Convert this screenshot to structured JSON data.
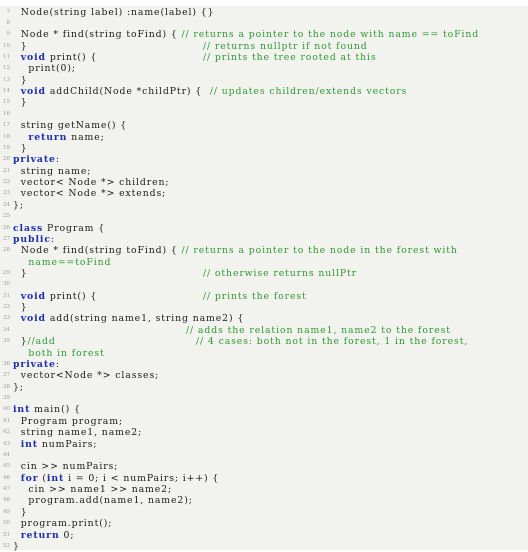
{
  "colors": {
    "keyword": "#1c2fb0",
    "comment": "#2e9a2e",
    "text": "#1a1a1a",
    "background": "#f2f2ef",
    "line_number": "#9a9a9a"
  },
  "lines": [
    {
      "n": "7",
      "segs": [
        {
          "t": "  Node(string label) :name(label) {}",
          "c": ""
        }
      ]
    },
    {
      "n": "8",
      "segs": []
    },
    {
      "n": "9",
      "segs": [
        {
          "t": "  Node * find(string toFind) { ",
          "c": ""
        },
        {
          "t": "// returns a pointer to the node with name == toFind",
          "c": "cm"
        }
      ]
    },
    {
      "n": "10",
      "segs": [
        {
          "t": "  }",
          "c": ""
        }
      ],
      "comment": "// returns nullptr if not found"
    },
    {
      "n": "11",
      "segs": [
        {
          "t": "  ",
          "c": ""
        },
        {
          "t": "void",
          "c": "kw"
        },
        {
          "t": " print() {",
          "c": ""
        }
      ],
      "comment": "// prints the tree rooted at this"
    },
    {
      "n": "12",
      "segs": [
        {
          "t": "    print(0);",
          "c": ""
        }
      ]
    },
    {
      "n": "13",
      "segs": [
        {
          "t": "  }",
          "c": ""
        }
      ]
    },
    {
      "n": "14",
      "segs": [
        {
          "t": "  ",
          "c": ""
        },
        {
          "t": "void",
          "c": "kw"
        },
        {
          "t": " addChild(Node *childPtr) {  ",
          "c": ""
        },
        {
          "t": "// updates children/extends vectors",
          "c": "cm"
        }
      ]
    },
    {
      "n": "15",
      "segs": [
        {
          "t": "  }",
          "c": ""
        }
      ]
    },
    {
      "n": "16",
      "segs": []
    },
    {
      "n": "17",
      "segs": [
        {
          "t": "  string getName() {",
          "c": ""
        }
      ]
    },
    {
      "n": "18",
      "segs": [
        {
          "t": "    ",
          "c": ""
        },
        {
          "t": "return",
          "c": "kw"
        },
        {
          "t": " name;",
          "c": ""
        }
      ]
    },
    {
      "n": "19",
      "segs": [
        {
          "t": "  }",
          "c": ""
        }
      ]
    },
    {
      "n": "20",
      "segs": [
        {
          "t": "private",
          "c": "kw"
        },
        {
          "t": ":",
          "c": ""
        }
      ]
    },
    {
      "n": "21",
      "segs": [
        {
          "t": "  string name;",
          "c": ""
        }
      ]
    },
    {
      "n": "22",
      "segs": [
        {
          "t": "  vector< Node *> children;",
          "c": ""
        }
      ]
    },
    {
      "n": "23",
      "segs": [
        {
          "t": "  vector< Node *> extends;",
          "c": ""
        }
      ]
    },
    {
      "n": "24",
      "segs": [
        {
          "t": "};",
          "c": ""
        }
      ]
    },
    {
      "n": "25",
      "segs": []
    },
    {
      "n": "26",
      "segs": [
        {
          "t": "class",
          "c": "kw"
        },
        {
          "t": " Program {",
          "c": ""
        }
      ]
    },
    {
      "n": "27",
      "segs": [
        {
          "t": "public",
          "c": "kw"
        },
        {
          "t": ":",
          "c": ""
        }
      ]
    },
    {
      "n": "28",
      "segs": [
        {
          "t": "  Node * find(string toFind) { ",
          "c": ""
        },
        {
          "t": "// returns a pointer to the node in the forest with",
          "c": "cm"
        }
      ]
    },
    {
      "n": "",
      "segs": [
        {
          "t": "    name==toFind",
          "c": "cm"
        }
      ]
    },
    {
      "n": "29",
      "segs": [
        {
          "t": "  }",
          "c": ""
        }
      ],
      "comment": "// otherwise returns nullPtr"
    },
    {
      "n": "30",
      "segs": []
    },
    {
      "n": "31",
      "segs": [
        {
          "t": "  ",
          "c": ""
        },
        {
          "t": "void",
          "c": "kw"
        },
        {
          "t": " print() {",
          "c": ""
        }
      ],
      "comment": "// prints the forest"
    },
    {
      "n": "32",
      "segs": [
        {
          "t": "  }",
          "c": ""
        }
      ]
    },
    {
      "n": "33",
      "segs": [
        {
          "t": "  ",
          "c": ""
        },
        {
          "t": "void",
          "c": "kw"
        },
        {
          "t": " add(string name1, string name2) {",
          "c": ""
        }
      ]
    },
    {
      "n": "34",
      "segs": [],
      "comment2": "// adds the relation name1, name2 to the forest"
    },
    {
      "n": "35",
      "segs": [
        {
          "t": "  }",
          "c": ""
        },
        {
          "t": "//add",
          "c": "cm"
        }
      ],
      "comment3": "// 4 cases: both not in the forest, 1 in the forest,"
    },
    {
      "n": "",
      "segs": [
        {
          "t": "    both in forest",
          "c": "cm"
        }
      ]
    },
    {
      "n": "36",
      "segs": [
        {
          "t": "private",
          "c": "kw"
        },
        {
          "t": ":",
          "c": ""
        }
      ]
    },
    {
      "n": "37",
      "segs": [
        {
          "t": "  vector<Node *> classes;",
          "c": ""
        }
      ]
    },
    {
      "n": "38",
      "segs": [
        {
          "t": "};",
          "c": ""
        }
      ]
    },
    {
      "n": "39",
      "segs": []
    },
    {
      "n": "40",
      "segs": [
        {
          "t": "int",
          "c": "kw"
        },
        {
          "t": " main() {",
          "c": ""
        }
      ]
    },
    {
      "n": "41",
      "segs": [
        {
          "t": "  Program program;",
          "c": ""
        }
      ]
    },
    {
      "n": "42",
      "segs": [
        {
          "t": "  string name1, name2;",
          "c": ""
        }
      ]
    },
    {
      "n": "43",
      "segs": [
        {
          "t": "  ",
          "c": ""
        },
        {
          "t": "int",
          "c": "kw"
        },
        {
          "t": " numPairs;",
          "c": ""
        }
      ]
    },
    {
      "n": "44",
      "segs": []
    },
    {
      "n": "45",
      "segs": [
        {
          "t": "  cin >> numPairs;",
          "c": ""
        }
      ]
    },
    {
      "n": "46",
      "segs": [
        {
          "t": "  ",
          "c": ""
        },
        {
          "t": "for",
          "c": "kw"
        },
        {
          "t": " (",
          "c": ""
        },
        {
          "t": "int",
          "c": "kw"
        },
        {
          "t": " i = 0; i < numPairs; i++) {",
          "c": ""
        }
      ]
    },
    {
      "n": "47",
      "segs": [
        {
          "t": "    cin >> name1 >> name2;",
          "c": ""
        }
      ]
    },
    {
      "n": "48",
      "segs": [
        {
          "t": "    program.add(name1, name2);",
          "c": ""
        }
      ]
    },
    {
      "n": "49",
      "segs": [
        {
          "t": "  }",
          "c": ""
        }
      ]
    },
    {
      "n": "50",
      "segs": [
        {
          "t": "  program.print();",
          "c": ""
        }
      ]
    },
    {
      "n": "51",
      "segs": [
        {
          "t": "  ",
          "c": ""
        },
        {
          "t": "return",
          "c": "kw"
        },
        {
          "t": " 0;",
          "c": ""
        }
      ]
    },
    {
      "n": "52",
      "segs": [
        {
          "t": "}",
          "c": ""
        }
      ]
    }
  ]
}
